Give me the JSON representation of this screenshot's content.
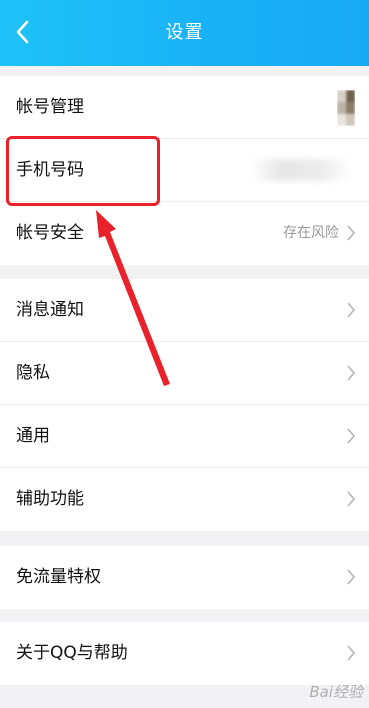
{
  "header": {
    "title": "设置"
  },
  "group1": [
    {
      "label": "帐号管理",
      "value": ""
    },
    {
      "label": "手机号码",
      "value": ""
    },
    {
      "label": "帐号安全",
      "value": "存在风险"
    }
  ],
  "group2": [
    {
      "label": "消息通知"
    },
    {
      "label": "隐私"
    },
    {
      "label": "通用"
    },
    {
      "label": "辅助功能"
    }
  ],
  "group3": [
    {
      "label": "免流量特权"
    }
  ],
  "group4": [
    {
      "label": "关于QQ与帮助"
    }
  ],
  "watermark": "Bai经验",
  "colors": {
    "header_start": "#1fc2f8",
    "header_end": "#18a9f5",
    "annotation_red": "#e8212a"
  }
}
